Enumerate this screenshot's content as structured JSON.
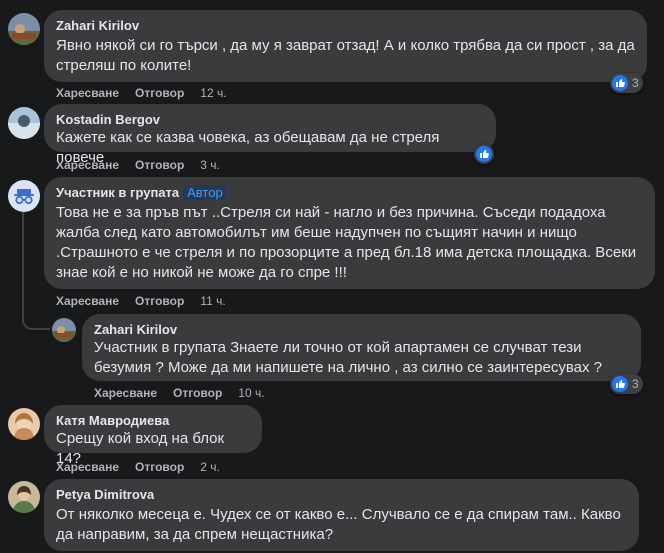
{
  "comments": [
    {
      "name": "Zahari Kirilov",
      "text": "Явно някой си го търси , да му я заврат отзад! А и колко трябва да си прост , за да стреляш по колите!",
      "like": "Харесване",
      "reply": "Отговор",
      "time": "12 ч.",
      "reactions": "3"
    },
    {
      "name": "Kostadin Bergov",
      "text": "Кажете как се казва човека, аз обещавам да не стреля повече",
      "like": "Харесване",
      "reply": "Отговор",
      "time": "3 ч."
    },
    {
      "name": "Участник в групата",
      "badge": "Автор",
      "text": "Това не е за пръв път ..Стреля си най - нагло и без причина. Съседи подадоха жалба след като автомобилът им беше надупчен по същият начин и нищо .Страшното е че стреля и по прозорците а пред бл.18 има детска площадка. Всеки знае кой е но никой не може да го спре !!!",
      "like": "Харесване",
      "reply": "Отговор",
      "time": "11 ч."
    },
    {
      "name": "Zahari Kirilov",
      "text": "Участник в групата Знаете ли точно от кой апартамен се случват тези безумия ? Може да ми напишете на лично , аз силно се заинтересувах ?",
      "like": "Харесване",
      "reply": "Отговор",
      "time": "10 ч.",
      "reactions": "3"
    },
    {
      "name": "Катя Мавродиева",
      "text": "Срещу кой вход на блок 14?",
      "like": "Харесване",
      "reply": "Отговор",
      "time": "2 ч."
    },
    {
      "name": "Petya Dimitrova",
      "text": "От няколко месеца е. Чудех се от какво е... Случвало се е да спирам там.. Какво да направим, за да спрем нещастника?"
    }
  ]
}
